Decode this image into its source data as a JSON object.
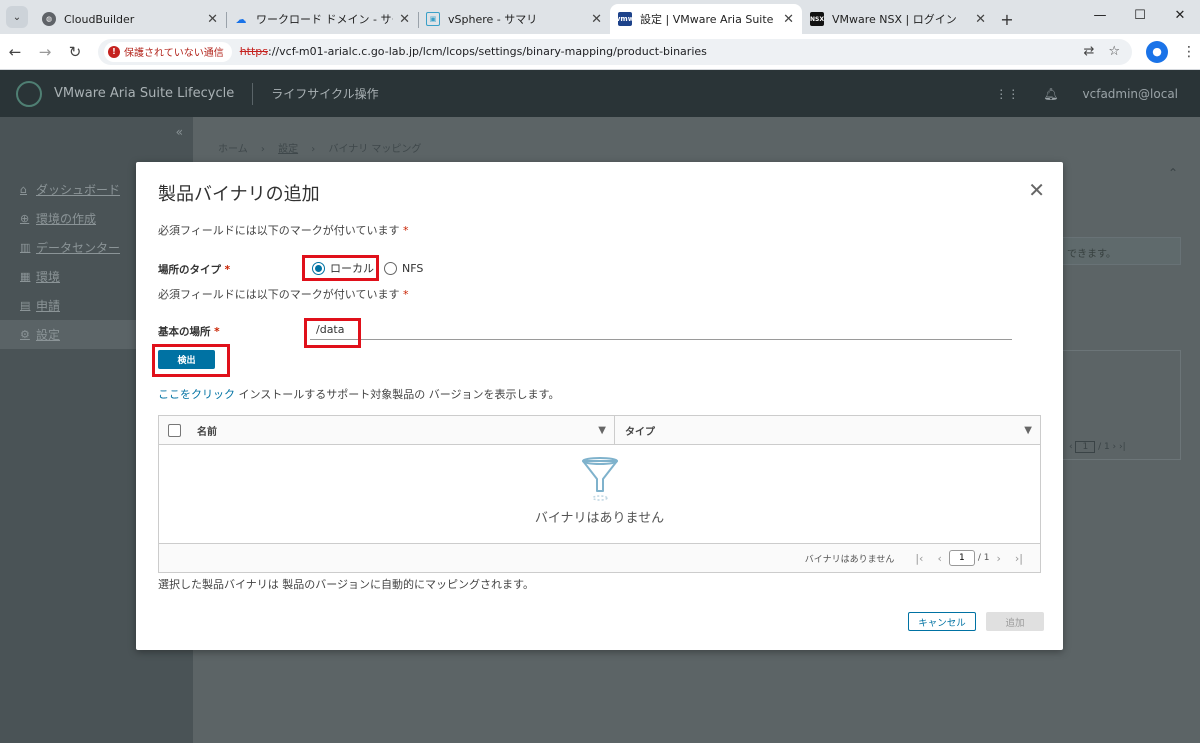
{
  "browser": {
    "tabs": [
      {
        "title": "CloudBuilder",
        "favicon": "globe-icon"
      },
      {
        "title": "ワークロード ドメイン - サービス",
        "favicon": "cloud-icon"
      },
      {
        "title": "vSphere - サマリ",
        "favicon": "vsphere-icon"
      },
      {
        "title": "設定 | VMware Aria Suite Lifecyc",
        "favicon": "vmw-icon",
        "favicon_text": "vmw"
      },
      {
        "title": "VMware NSX | ログイン",
        "favicon": "nsx-icon",
        "favicon_text": "NSX"
      }
    ],
    "active_tab": 3,
    "security_label": "保護されていない通信",
    "url_scheme": "https",
    "url_rest": "://vcf-m01-arialc.c.go-lab.jp/lcm/lcops/settings/binary-mapping/product-binaries"
  },
  "app": {
    "title": "VMware Aria Suite Lifecycle",
    "nav": "ライフサイクル操作",
    "user": "vcfadmin@local",
    "sidebar": [
      {
        "label": "ダッシュボード",
        "icon": "home-icon"
      },
      {
        "label": "環境の作成",
        "icon": "plus-circle-icon"
      },
      {
        "label": "データセンター",
        "icon": "building-icon"
      },
      {
        "label": "環境",
        "icon": "grid-icon"
      },
      {
        "label": "申請",
        "icon": "clipboard-icon"
      },
      {
        "label": "設定",
        "icon": "gear-icon"
      }
    ],
    "breadcrumb": [
      "ホーム",
      "設定",
      "バイナリ マッピング"
    ],
    "notice_fragment": "できます。",
    "pager_fragment": "1"
  },
  "modal": {
    "title": "製品バイナリの追加",
    "required_note": "必須フィールドには以下のマークが付いています",
    "required_star": "*",
    "location_type_label": "場所のタイプ",
    "radio_local": "ローカル",
    "radio_nfs": "NFS",
    "base_location_label": "基本の場所",
    "base_location_value": "/data",
    "detect_button": "検出",
    "info_link": "ここをクリック",
    "info_text": " インストールするサポート対象製品の バージョンを表示します。",
    "grid": {
      "columns": [
        "名前",
        "タイプ"
      ],
      "empty_message": "バイナリはありません",
      "footer_summary": "バイナリはありません",
      "page_value": "1",
      "page_total": "/ 1"
    },
    "auto_map_note": "選択した製品バイナリは 製品のバージョンに自動的にマッピングされます。",
    "cancel_button": "キャンセル",
    "add_button": "追加"
  }
}
